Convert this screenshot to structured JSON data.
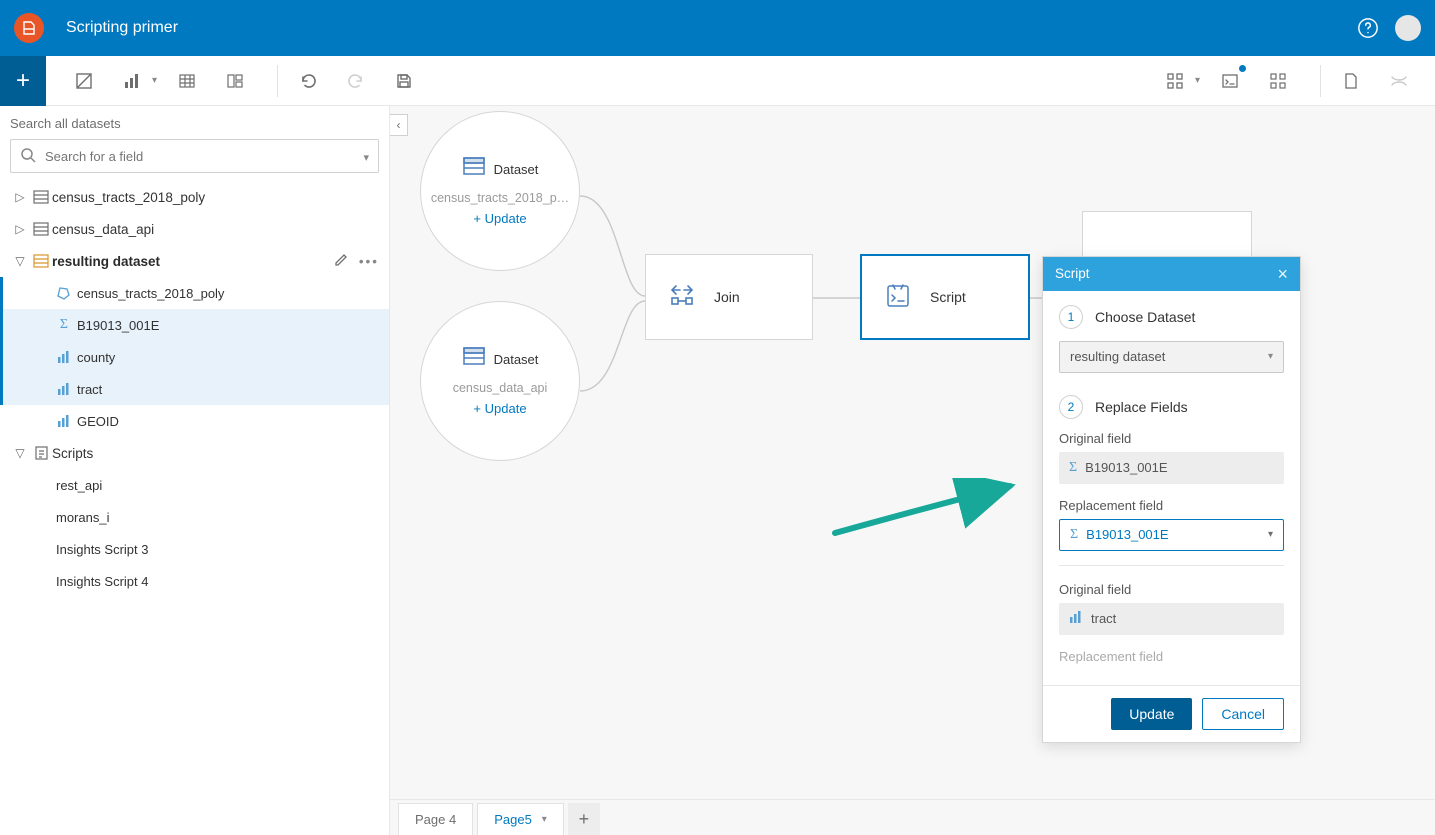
{
  "header": {
    "title": "Scripting primer"
  },
  "sidebar": {
    "search_title": "Search all datasets",
    "search_placeholder": "Search for a field",
    "datasets": [
      {
        "name": "census_tracts_2018_poly",
        "expanded": false
      },
      {
        "name": "census_data_api",
        "expanded": false
      }
    ],
    "resulting": {
      "label": "resulting dataset",
      "fields": [
        {
          "name": "census_tracts_2018_poly",
          "icon": "polygon",
          "sel": "active"
        },
        {
          "name": "B19013_001E",
          "icon": "sigma",
          "sel": "active_bg"
        },
        {
          "name": "county",
          "icon": "bars",
          "sel": "active_bg"
        },
        {
          "name": "tract",
          "icon": "bars",
          "sel": "active_bg"
        },
        {
          "name": "GEOID",
          "icon": "bars",
          "sel": "none"
        }
      ]
    },
    "scripts": {
      "label": "Scripts",
      "items": [
        "rest_api",
        "morans_i",
        "Insights Script 3",
        "Insights Script 4"
      ]
    }
  },
  "canvas": {
    "dataset_label": "Dataset",
    "update_label": "Update",
    "nodes": {
      "ds1": {
        "sub": "census_tracts_2018_p…"
      },
      "ds2": {
        "sub": "census_data_api"
      },
      "join": {
        "label": "Join"
      },
      "script": {
        "label": "Script"
      }
    }
  },
  "popup": {
    "title": "Script",
    "step1": "Choose Dataset",
    "ds_value": "resulting dataset",
    "step2": "Replace Fields",
    "orig_label": "Original field",
    "repl_label": "Replacement field",
    "pairs": [
      {
        "orig": "B19013_001E",
        "orig_icon": "sigma",
        "repl": "B19013_001E",
        "repl_icon": "sigma"
      },
      {
        "orig": "tract",
        "orig_icon": "bars"
      }
    ],
    "truncated_label": "Replacement field",
    "update_btn": "Update",
    "cancel_btn": "Cancel"
  },
  "pages": {
    "tabs": [
      {
        "label": "Page 4",
        "active": false
      },
      {
        "label": "Page5",
        "active": true
      }
    ]
  }
}
